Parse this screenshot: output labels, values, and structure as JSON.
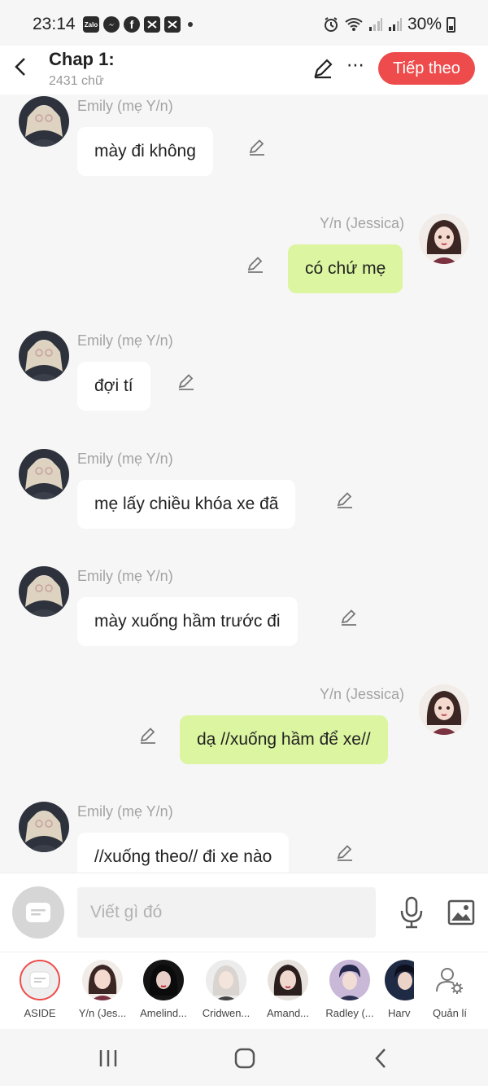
{
  "status_bar": {
    "time": "23:14",
    "battery": "30%",
    "apps": [
      "Zalo",
      "messenger-icon",
      "facebook-icon",
      "capcut-icon",
      "capcut-icon"
    ]
  },
  "header": {
    "title": "Chap 1:",
    "word_count": "2431 chữ",
    "next_button": "Tiếp theo",
    "more_label": "⋯"
  },
  "messages": [
    {
      "side": "left",
      "sender": "Emily (mẹ Y/n)",
      "text": "mày đi không"
    },
    {
      "side": "right",
      "sender": "Y/n (Jessica)",
      "text": "có chứ mẹ"
    },
    {
      "side": "left",
      "sender": "Emily (mẹ Y/n)",
      "text": "đợi tí"
    },
    {
      "side": "left",
      "sender": "Emily (mẹ Y/n)",
      "text": "mẹ lấy chiều khóa xe đã"
    },
    {
      "side": "left",
      "sender": "Emily (mẹ Y/n)",
      "text": "mày xuống hầm trước đi"
    },
    {
      "side": "right",
      "sender": "Y/n (Jessica)",
      "text": "dạ //xuống hầm để xe//"
    },
    {
      "side": "left",
      "sender": "Emily (mẹ Y/n)",
      "text": "//xuống theo// đi xe nào"
    }
  ],
  "input": {
    "placeholder": "Viết gì đó"
  },
  "characters": [
    {
      "name": "ASIDE"
    },
    {
      "name": "Y/n (Jes..."
    },
    {
      "name": "Amelind..."
    },
    {
      "name": "Cridwen..."
    },
    {
      "name": "Amand..."
    },
    {
      "name": "Radley (..."
    },
    {
      "name": "Harv"
    },
    {
      "name": "Quản lí"
    }
  ],
  "colors": {
    "accent": "#ee4c4c",
    "right_bubble": "#dcf5a0",
    "left_bubble": "#ffffff",
    "background": "#f6f6f6"
  }
}
